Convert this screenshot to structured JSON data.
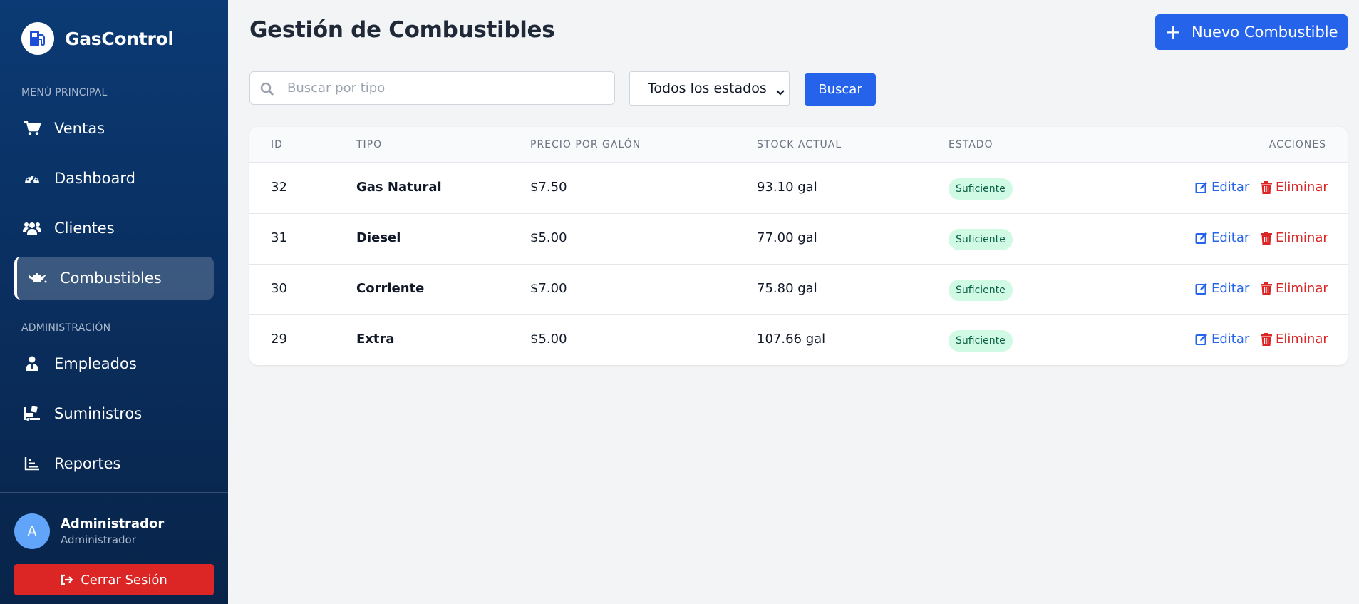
{
  "app": {
    "name": "GasControl"
  },
  "sidebar": {
    "main_label": "MENÚ PRINCIPAL",
    "main_items": [
      {
        "label": "Ventas",
        "icon": "cart-icon"
      },
      {
        "label": "Dashboard",
        "icon": "gauge-icon"
      },
      {
        "label": "Clientes",
        "icon": "users-icon"
      },
      {
        "label": "Combustibles",
        "icon": "oil-can-icon",
        "active": true
      }
    ],
    "admin_label": "ADMINISTRACIÓN",
    "admin_items": [
      {
        "label": "Empleados",
        "icon": "user-tie-icon"
      },
      {
        "label": "Suministros",
        "icon": "truck-loading-icon"
      },
      {
        "label": "Reportes",
        "icon": "chart-bar-icon"
      }
    ],
    "user": {
      "initial": "A",
      "name": "Administrador",
      "role": "Administrador"
    },
    "logout_label": "Cerrar Sesión"
  },
  "header": {
    "title": "Gestión de Combustibles",
    "new_button": "Nuevo Combustible"
  },
  "filters": {
    "search_placeholder": "Buscar por tipo",
    "search_value": "",
    "status_selected": "Todos los estados",
    "search_button": "Buscar"
  },
  "table": {
    "columns": [
      "ID",
      "TIPO",
      "PRECIO POR GALÓN",
      "STOCK ACTUAL",
      "ESTADO",
      "ACCIONES"
    ],
    "rows": [
      {
        "id": "32",
        "tipo": "Gas Natural",
        "precio": "$7.50",
        "stock": "93.10 gal",
        "estado": "Suficiente"
      },
      {
        "id": "31",
        "tipo": "Diesel",
        "precio": "$5.00",
        "stock": "77.00 gal",
        "estado": "Suficiente"
      },
      {
        "id": "30",
        "tipo": "Corriente",
        "precio": "$7.00",
        "stock": "75.80 gal",
        "estado": "Suficiente"
      },
      {
        "id": "29",
        "tipo": "Extra",
        "precio": "$5.00",
        "stock": "107.66 gal",
        "estado": "Suficiente"
      }
    ],
    "edit_label": "Editar",
    "delete_label": "Eliminar"
  },
  "colors": {
    "sidebar": "#0b3a74",
    "primary": "#2563eb",
    "danger": "#dc2626",
    "badge_bg": "#d1fae5",
    "badge_text": "#065f46"
  }
}
